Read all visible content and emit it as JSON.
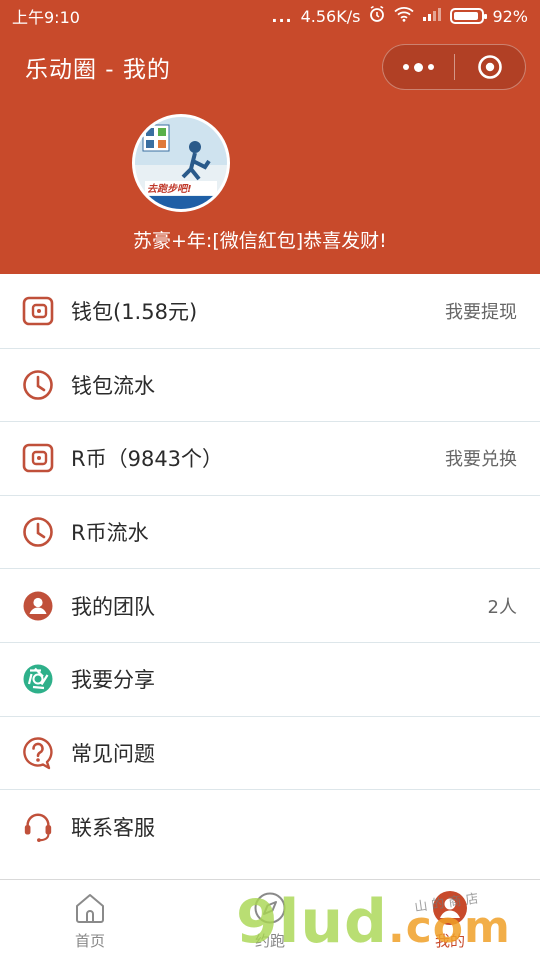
{
  "status_bar": {
    "time": "上午9:10",
    "dots": "...",
    "network_speed": "4.56K/s",
    "battery": "92%",
    "icons": [
      "alarm-icon",
      "wifi-icon",
      "signal-icon",
      "battery-icon"
    ]
  },
  "nav": {
    "title": "乐动圈 - 我的",
    "capsule": {
      "more_icon": "more-dots-icon",
      "close_icon": "target-circle-icon"
    }
  },
  "profile": {
    "avatar_text": "去跑步吧!",
    "welcome": "苏豪+年:[微信紅包]恭喜发财!"
  },
  "menu": {
    "items": [
      {
        "label": "钱包(1.58元)",
        "right": "我要提现",
        "icon": "wallet-icon"
      },
      {
        "label": "钱包流水",
        "right": "",
        "icon": "clock-icon"
      },
      {
        "label": "R币（9843个）",
        "right": "我要兑换",
        "icon": "wallet-icon"
      },
      {
        "label": "R币流水",
        "right": "",
        "icon": "clock-icon"
      },
      {
        "label": "我的团队",
        "right": "2人",
        "icon": "person-icon"
      },
      {
        "label": "我要分享",
        "right": "",
        "icon": "share-aperture-icon"
      },
      {
        "label": "常见问题",
        "right": "",
        "icon": "question-icon"
      },
      {
        "label": "联系客服",
        "right": "",
        "icon": "headset-icon"
      }
    ]
  },
  "tabs": [
    {
      "label": "首页",
      "icon": "home-icon",
      "active": false
    },
    {
      "label": "约跑",
      "icon": "compass-icon",
      "active": false
    },
    {
      "label": "我的",
      "icon": "avatar-icon",
      "active": true
    }
  ],
  "watermark": {
    "main": "9lud",
    "suffix": ".com",
    "small": "山 的 商 店"
  },
  "colors": {
    "brand": "#c84a2b",
    "icon_red": "#c0503a",
    "share_green": "#2eb08a",
    "divider": "#dde6ea"
  }
}
